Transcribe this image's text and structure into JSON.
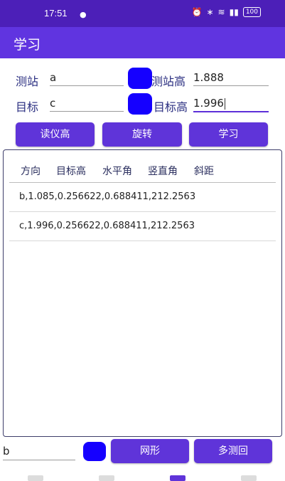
{
  "status": {
    "time": "17:51",
    "battery": "100"
  },
  "app": {
    "title": "学习"
  },
  "form": {
    "station_label": "测站",
    "station_value": "a",
    "station_height_label": "测站高",
    "station_height_value": "1.888",
    "target_label": "目标",
    "target_value": "c",
    "target_height_label": "目标高",
    "target_height_value": "1.996"
  },
  "buttons": {
    "read_instrument": "读仪高",
    "rotate": "旋转",
    "learn": "学习",
    "net_shape": "网形",
    "multi_round": "多测回"
  },
  "table": {
    "headers": [
      "方向",
      "目标高",
      "水平角",
      "竖直角",
      "斜距"
    ],
    "rows": [
      "b,1.085,0.256622,0.688411,212.2563",
      "c,1.996,0.256622,0.688411,212.2563"
    ]
  },
  "bottom": {
    "input_value": "b"
  },
  "colors": {
    "status_bar": "#4c1fb8",
    "app_bar": "#6034e0",
    "accent": "#5f34d9",
    "swatch": "#1500ff"
  }
}
